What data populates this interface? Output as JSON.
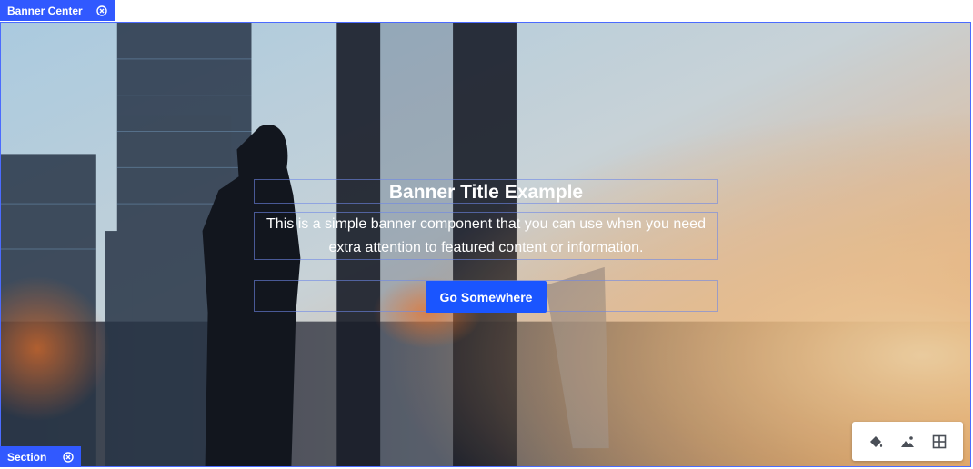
{
  "colors": {
    "accent": "#1a55ff",
    "tab_bg": "#3159ff",
    "icon_gray": "#4a4f57"
  },
  "editor": {
    "top_tab": {
      "label": "Banner Center",
      "close_icon": "close-circle-icon"
    },
    "bottom_tab": {
      "label": "Section",
      "close_icon": "close-circle-icon"
    }
  },
  "banner": {
    "background": "city-skyline-photo",
    "title": "Banner Title Example",
    "description": "This is a simple banner component that you can use when you need extra attention to featured content or information.",
    "button_label": "Go Somewhere"
  },
  "toolbar": {
    "items": [
      {
        "name": "paint-bucket-icon"
      },
      {
        "name": "image-icon"
      },
      {
        "name": "grid-icon"
      }
    ]
  }
}
